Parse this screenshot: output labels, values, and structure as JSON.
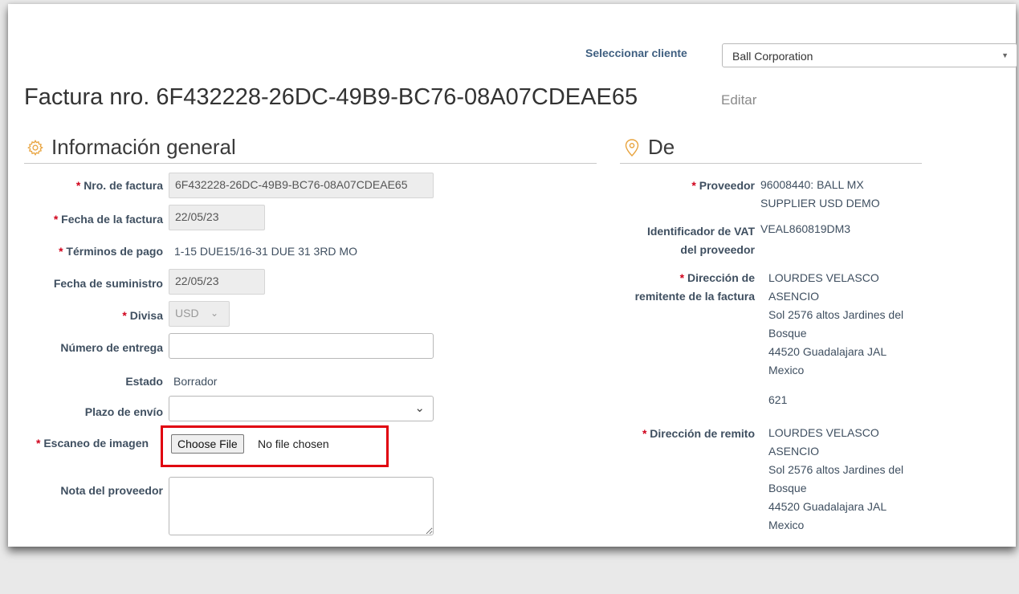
{
  "header": {
    "customer_select_label": "Seleccionar cliente",
    "customer_selected": "Ball Corporation",
    "title": "Factura nro. 6F432228-26DC-49B9-BC76-08A07CDEAE65",
    "edit_link": "Editar"
  },
  "general": {
    "section_title": "Información general",
    "icon": "gear-icon",
    "invoice_number_label": "Nro. de factura",
    "invoice_number": "6F432228-26DC-49B9-BC76-08A07CDEAE65",
    "invoice_date_label": "Fecha de la factura",
    "invoice_date": "22/05/23",
    "payment_terms_label": "Términos de pago",
    "payment_terms": "1-15 DUE15/16-31 DUE 31 3RD MO",
    "supply_date_label": "Fecha de suministro",
    "supply_date": "22/05/23",
    "currency_label": "Divisa",
    "currency": "USD",
    "delivery_number_label": "Número de entrega",
    "delivery_number": "",
    "status_label": "Estado",
    "status": "Borrador",
    "shipping_term_label": "Plazo de envío",
    "shipping_term": "",
    "image_scan_label": "Escaneo de imagen",
    "choose_file_button": "Choose File",
    "no_file_text": "No file chosen",
    "supplier_note_label": "Nota del proveedor",
    "supplier_note": ""
  },
  "from": {
    "section_title": "De",
    "icon": "map-pin-icon",
    "supplier_label": "Proveedor",
    "supplier_lines": [
      "96008440: BALL MX",
      "SUPPLIER USD DEMO"
    ],
    "vat_label_lines": [
      "Identificador de VAT",
      "del proveedor"
    ],
    "vat_value": "VEAL860819DM3",
    "remit_label_lines": [
      "Dirección de",
      "remitente de la factura"
    ],
    "remit_lines": [
      "LOURDES VELASCO",
      "ASENCIO",
      "Sol 2576 altos Jardines del",
      "Bosque",
      "44520 Guadalajara JAL",
      "Mexico"
    ],
    "remit_extra": "621",
    "ship_label": "Dirección de remito",
    "ship_lines": [
      "LOURDES VELASCO",
      "ASENCIO",
      "Sol 2576 altos Jardines del",
      "Bosque",
      "44520 Guadalajara JAL",
      "Mexico"
    ]
  },
  "colors": {
    "required": "#d0021b",
    "icon_orange": "#e8a33d",
    "highlight_red": "#e0000f"
  }
}
